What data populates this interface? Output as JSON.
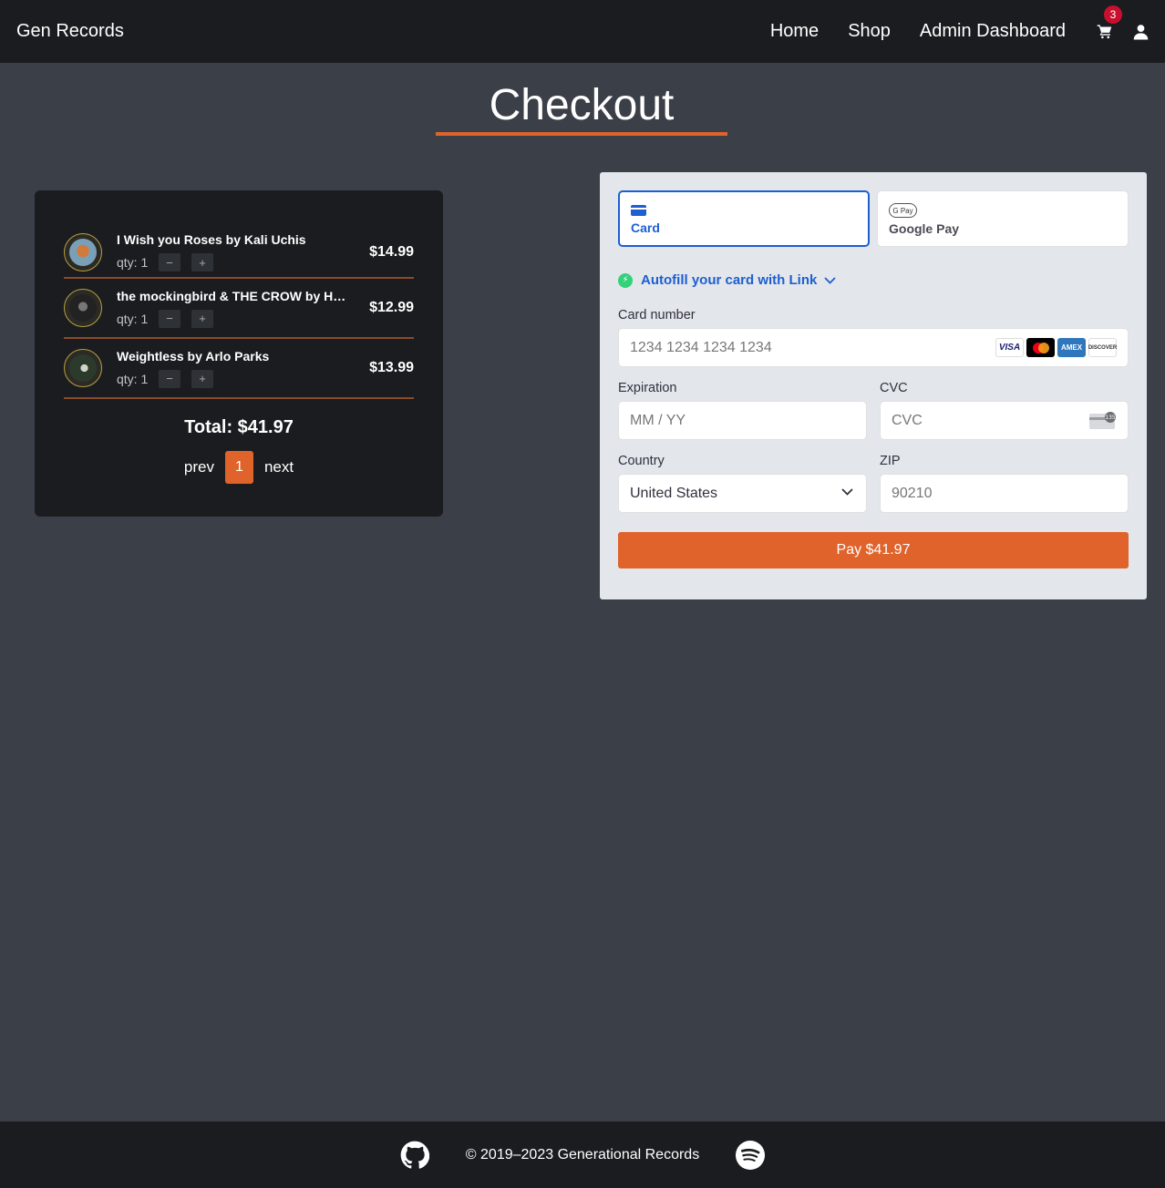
{
  "navbar": {
    "brand": "Gen Records",
    "links": [
      "Home",
      "Shop",
      "Admin Dashboard"
    ],
    "cart_count": "3"
  },
  "page_title": "Checkout",
  "cart": {
    "items": [
      {
        "name": "I Wish you Roses by Kali Uchis",
        "qty": "qty: 1",
        "price": "$14.99"
      },
      {
        "name": "the mockingbird & THE CROW by HA...",
        "qty": "qty: 1",
        "price": "$12.99"
      },
      {
        "name": "Weightless by Arlo Parks",
        "qty": "qty: 1",
        "price": "$13.99"
      }
    ],
    "qty_minus": "−",
    "qty_plus": "+",
    "total": "Total: $41.97",
    "pager": {
      "prev": "prev",
      "current": "1",
      "next": "next"
    }
  },
  "payment": {
    "tabs": [
      {
        "label": "Card",
        "active": true
      },
      {
        "label": "Google Pay",
        "active": false
      }
    ],
    "gpay_icon_text": "G Pay",
    "autofill": "Autofill your card with Link",
    "card_number_label": "Card number",
    "card_number_placeholder": "1234 1234 1234 1234",
    "card_brands": [
      "VISA",
      "Mastercard",
      "AMEX",
      "DISCOVER"
    ],
    "expiration_label": "Expiration",
    "expiration_placeholder": "MM / YY",
    "cvc_label": "CVC",
    "cvc_placeholder": "CVC",
    "cvc_icon_text": "135",
    "country_label": "Country",
    "country_value": "United States",
    "zip_label": "ZIP",
    "zip_placeholder": "90210",
    "pay_button": "Pay $41.97"
  },
  "footer": {
    "copyright": "© 2019–2023 Generational Records"
  },
  "colors": {
    "accent": "#e0632b",
    "background": "#3b3f47",
    "panel": "#1a1c1f",
    "link_blue": "#1d5fd1"
  }
}
